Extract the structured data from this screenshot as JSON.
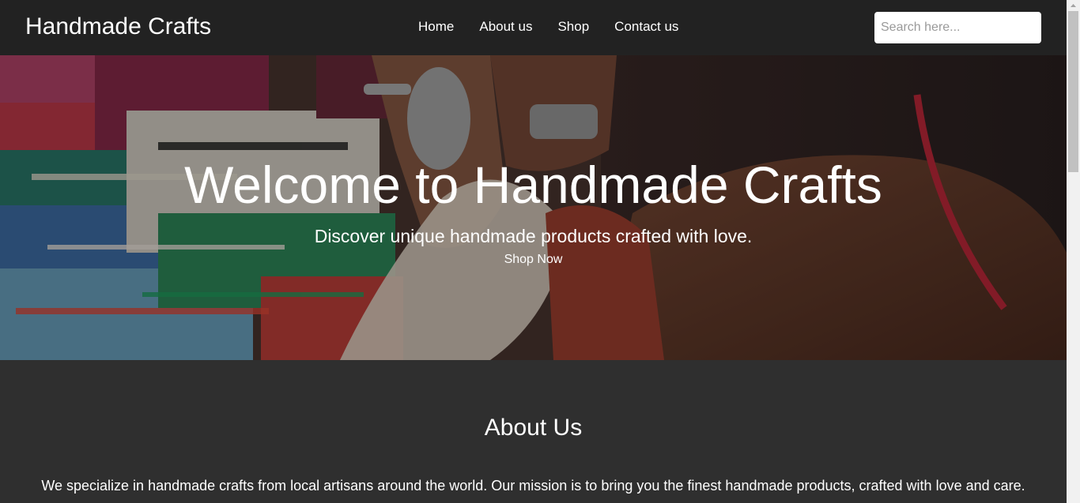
{
  "header": {
    "brand": "Handmade Crafts",
    "nav": {
      "home": "Home",
      "about": "About us",
      "shop": "Shop",
      "contact": "Contact us"
    },
    "search": {
      "placeholder": "Search here...",
      "value": ""
    }
  },
  "hero": {
    "title": "Welcome to Handmade Crafts",
    "subtitle": "Discover unique handmade products crafted with love.",
    "cta": "Shop Now"
  },
  "about": {
    "title": "About Us",
    "text": "We specialize in handmade crafts from local artisans around the world. Our mission is to bring you the finest handmade products, crafted with love and care."
  },
  "colors": {
    "header_bg": "#222222",
    "page_bg": "#2f2f2f",
    "text": "#ffffff"
  }
}
